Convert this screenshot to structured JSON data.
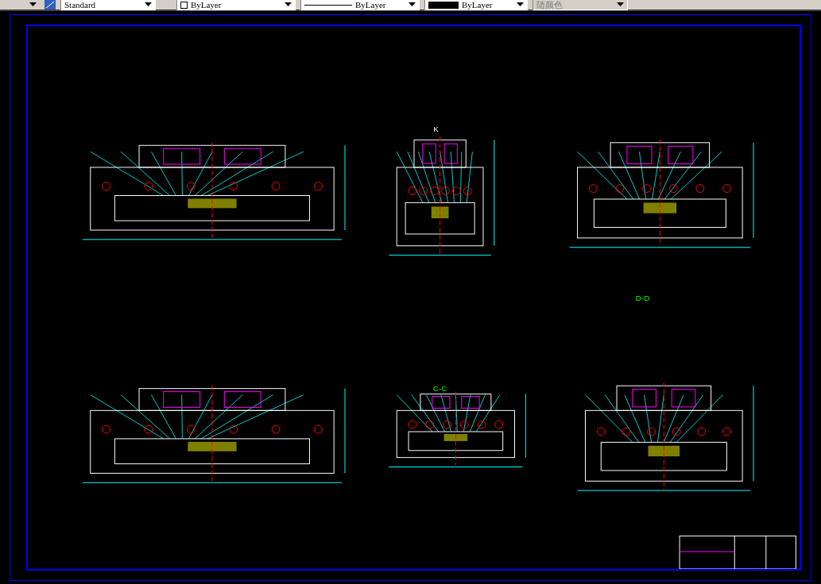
{
  "toolbar": {
    "text_style": "Standard",
    "layer_color_control": "ByLayer",
    "linetype": "ByLayer",
    "lineweight": "ByLayer",
    "plot_style": {
      "value": "随颜色",
      "disabled": true
    }
  },
  "drawing": {
    "view_labels": [
      {
        "text": "K",
        "kind": "view"
      },
      {
        "text": "D-D",
        "kind": "section"
      },
      {
        "text": "C-C",
        "kind": "section"
      }
    ]
  }
}
